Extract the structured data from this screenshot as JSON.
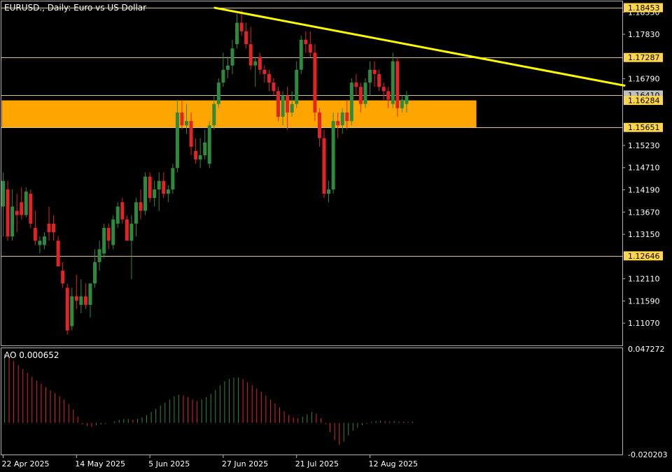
{
  "window": {
    "title": "EURUSD., Daily:  Euro vs US Dollar",
    "ao_label": "AO 0.000652"
  },
  "colors": {
    "background": "#000000",
    "frame": "#b4b4b4",
    "bull_candle": "#2e8b3d",
    "bear_candle": "#e22424",
    "zone": "#ffa500",
    "trendline": "#ffff00",
    "hline": "#d8c48a",
    "label_bg": "#ffd54a",
    "current_price_bg": "#c0c0c0"
  },
  "chart_data": [
    {
      "type": "candlestick",
      "symbol": "EURUSD.",
      "timeframe": "Daily",
      "ylim": [
        1.1055,
        1.186
      ],
      "y_ticks": [
        "1.18350",
        "1.17830",
        "1.16790",
        "1.15230",
        "1.14710",
        "1.14190",
        "1.13670",
        "1.13150",
        "1.12110",
        "1.11590",
        "1.11070"
      ],
      "x_ticks": [
        {
          "label": "22 Apr 2025",
          "index": 0
        },
        {
          "label": "14 May 2025",
          "index": 16
        },
        {
          "label": "5 Jun 2025",
          "index": 32
        },
        {
          "label": "27 Jun 2025",
          "index": 48
        },
        {
          "label": "21 Jul 2025",
          "index": 64
        },
        {
          "label": "12 Aug 2025",
          "index": 80
        }
      ],
      "price_labels": [
        {
          "value": 1.18453,
          "text": "1.18453"
        },
        {
          "value": 1.17287,
          "text": "1.17287"
        },
        {
          "value": 1.1641,
          "text": "1.16410",
          "current": true
        },
        {
          "value": 1.16284,
          "text": "1.16284"
        },
        {
          "value": 1.15651,
          "text": "1.15651"
        },
        {
          "value": 1.12646,
          "text": "1.12646"
        }
      ],
      "horizontal_lines": [
        1.18453,
        1.17287,
        1.1641,
        1.15651,
        1.12646
      ],
      "zone": {
        "from": 1.15651,
        "to": 1.16284,
        "index_start": 0,
        "index_end": 102
      },
      "trendline": [
        {
          "index": 48,
          "price": 1.1845
        },
        {
          "index": 110,
          "price": 1.1663
        }
      ],
      "ohlc": [
        [
          1.138,
          1.146,
          1.131,
          1.144
        ],
        [
          1.142,
          1.144,
          1.13,
          1.131
        ],
        [
          1.131,
          1.142,
          1.13,
          1.138
        ],
        [
          1.137,
          1.141,
          1.132,
          1.136
        ],
        [
          1.139,
          1.1425,
          1.135,
          1.136
        ],
        [
          1.136,
          1.1425,
          1.1355,
          1.1415
        ],
        [
          1.141,
          1.142,
          1.133,
          1.134
        ],
        [
          1.133,
          1.137,
          1.129,
          1.13
        ],
        [
          1.129,
          1.131,
          1.127,
          1.13
        ],
        [
          1.129,
          1.132,
          1.128,
          1.131
        ],
        [
          1.134,
          1.138,
          1.13,
          1.132
        ],
        [
          1.134,
          1.136,
          1.13,
          1.132
        ],
        [
          1.13,
          1.131,
          1.124,
          1.124
        ],
        [
          1.123,
          1.125,
          1.119,
          1.12
        ],
        [
          1.119,
          1.12,
          1.108,
          1.109
        ],
        [
          1.11,
          1.119,
          1.109,
          1.117
        ],
        [
          1.117,
          1.122,
          1.114,
          1.116
        ],
        [
          1.115,
          1.121,
          1.113,
          1.117
        ],
        [
          1.117,
          1.12,
          1.114,
          1.115
        ],
        [
          1.115,
          1.12,
          1.112,
          1.12
        ],
        [
          1.12,
          1.128,
          1.119,
          1.125
        ],
        [
          1.125,
          1.13,
          1.123,
          1.128
        ],
        [
          1.127,
          1.134,
          1.126,
          1.133
        ],
        [
          1.133,
          1.134,
          1.128,
          1.13
        ],
        [
          1.129,
          1.136,
          1.128,
          1.135
        ],
        [
          1.134,
          1.139,
          1.133,
          1.138
        ],
        [
          1.139,
          1.14,
          1.134,
          1.135
        ],
        [
          1.135,
          1.136,
          1.13,
          1.13
        ],
        [
          1.13,
          1.136,
          1.121,
          1.134
        ],
        [
          1.134,
          1.14,
          1.131,
          1.139
        ],
        [
          1.139,
          1.142,
          1.135,
          1.137
        ],
        [
          1.137,
          1.146,
          1.136,
          1.145
        ],
        [
          1.145,
          1.146,
          1.139,
          1.14
        ],
        [
          1.14,
          1.144,
          1.138,
          1.142
        ],
        [
          1.142,
          1.146,
          1.137,
          1.144
        ],
        [
          1.144,
          1.146,
          1.14,
          1.141
        ],
        [
          1.141,
          1.143,
          1.139,
          1.142
        ],
        [
          1.142,
          1.148,
          1.141,
          1.147
        ],
        [
          1.147,
          1.163,
          1.146,
          1.16
        ],
        [
          1.16,
          1.163,
          1.156,
          1.157
        ],
        [
          1.157,
          1.162,
          1.155,
          1.158
        ],
        [
          1.158,
          1.16,
          1.15,
          1.152
        ],
        [
          1.151,
          1.154,
          1.148,
          1.149
        ],
        [
          1.149,
          1.154,
          1.147,
          1.15
        ],
        [
          1.15,
          1.156,
          1.149,
          1.153
        ],
        [
          1.148,
          1.158,
          1.147,
          1.157
        ],
        [
          1.157,
          1.164,
          1.156,
          1.162
        ],
        [
          1.162,
          1.168,
          1.161,
          1.167
        ],
        [
          1.167,
          1.174,
          1.166,
          1.17
        ],
        [
          1.17,
          1.173,
          1.168,
          1.171
        ],
        [
          1.171,
          1.177,
          1.169,
          1.175
        ],
        [
          1.176,
          1.183,
          1.175,
          1.181
        ],
        [
          1.181,
          1.184,
          1.178,
          1.179
        ],
        [
          1.179,
          1.181,
          1.175,
          1.176
        ],
        [
          1.176,
          1.18,
          1.17,
          1.171
        ],
        [
          1.171,
          1.173,
          1.166,
          1.172
        ],
        [
          1.173,
          1.174,
          1.169,
          1.17
        ],
        [
          1.17,
          1.171,
          1.167,
          1.169
        ],
        [
          1.169,
          1.17,
          1.165,
          1.167
        ],
        [
          1.167,
          1.168,
          1.164,
          1.165
        ],
        [
          1.165,
          1.166,
          1.158,
          1.159
        ],
        [
          1.159,
          1.165,
          1.157,
          1.164
        ],
        [
          1.164,
          1.166,
          1.156,
          1.16
        ],
        [
          1.16,
          1.165,
          1.159,
          1.162
        ],
        [
          1.162,
          1.172,
          1.161,
          1.17
        ],
        [
          1.17,
          1.178,
          1.169,
          1.177
        ],
        [
          1.177,
          1.179,
          1.174,
          1.176
        ],
        [
          1.176,
          1.179,
          1.173,
          1.174
        ],
        [
          1.174,
          1.176,
          1.158,
          1.16
        ],
        [
          1.16,
          1.161,
          1.152,
          1.154
        ],
        [
          1.154,
          1.156,
          1.14,
          1.141
        ],
        [
          1.141,
          1.144,
          1.139,
          1.142
        ],
        [
          1.142,
          1.16,
          1.141,
          1.158
        ],
        [
          1.158,
          1.16,
          1.154,
          1.157
        ],
        [
          1.157,
          1.161,
          1.155,
          1.16
        ],
        [
          1.16,
          1.163,
          1.156,
          1.158
        ],
        [
          1.158,
          1.168,
          1.157,
          1.167
        ],
        [
          1.167,
          1.169,
          1.164,
          1.166
        ],
        [
          1.166,
          1.167,
          1.16,
          1.162
        ],
        [
          1.162,
          1.168,
          1.161,
          1.167
        ],
        [
          1.167,
          1.172,
          1.164,
          1.17
        ],
        [
          1.17,
          1.172,
          1.166,
          1.169
        ],
        [
          1.169,
          1.17,
          1.165,
          1.166
        ],
        [
          1.166,
          1.167,
          1.163,
          1.165
        ],
        [
          1.165,
          1.166,
          1.161,
          1.163
        ],
        [
          1.162,
          1.174,
          1.161,
          1.172
        ],
        [
          1.172,
          1.173,
          1.159,
          1.161
        ],
        [
          1.161,
          1.164,
          1.16,
          1.163
        ],
        [
          1.162,
          1.165,
          1.16,
          1.164
        ]
      ]
    },
    {
      "type": "bar",
      "name": "AO",
      "ylim": [
        -0.020203,
        0.047272
      ],
      "y_ticks": [
        "0.047272",
        "-0.020203"
      ],
      "values": [
        0.044,
        0.042,
        0.0395,
        0.037,
        0.0345,
        0.032,
        0.0295,
        0.027,
        0.025,
        0.023,
        0.021,
        0.019,
        0.017,
        0.015,
        0.012,
        0.0085,
        0.004,
        -0.001,
        -0.002,
        -0.0025,
        -0.0015,
        -0.001,
        -0.0005,
        0.0,
        0.001,
        0.002,
        0.0025,
        0.0025,
        0.002,
        0.0025,
        0.0035,
        0.005,
        0.007,
        0.009,
        0.011,
        0.013,
        0.015,
        0.017,
        0.018,
        0.0175,
        0.0165,
        0.015,
        0.014,
        0.015,
        0.0165,
        0.0185,
        0.021,
        0.024,
        0.0265,
        0.028,
        0.029,
        0.029,
        0.028,
        0.026,
        0.024,
        0.022,
        0.02,
        0.0175,
        0.015,
        0.0125,
        0.01,
        0.0075,
        0.005,
        0.0035,
        0.003,
        0.004,
        0.0055,
        0.007,
        0.006,
        0.003,
        -0.001,
        -0.006,
        -0.011,
        -0.014,
        -0.012,
        -0.008,
        -0.005,
        -0.003,
        -0.0015,
        -0.0005,
        0.0005,
        0.0012,
        0.0015,
        0.0012,
        0.001,
        0.0012,
        0.001,
        0.0008,
        0.0006,
        0.0007
      ]
    }
  ]
}
